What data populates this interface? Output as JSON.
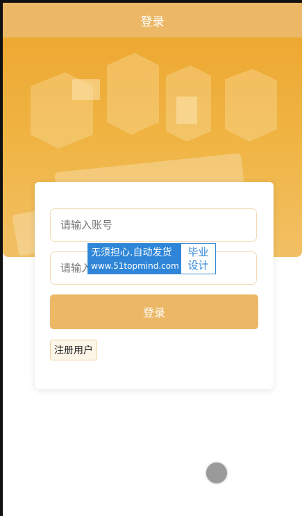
{
  "header": {
    "title": "登录"
  },
  "login_form": {
    "account_placeholder": "请输入账号",
    "password_placeholder": "请输入密码",
    "login_label": "登录",
    "register_label": "注册用户"
  },
  "watermark": {
    "slogan": "无须担心.自动发货",
    "url": "www.51topmind.com",
    "tag_line1": "毕业",
    "tag_line2": "设计"
  },
  "colors": {
    "accent": "#ecb866",
    "hero": "#f0b545",
    "field_border": "#f2dcb8",
    "watermark_blue": "#2f86d8"
  },
  "icons": {
    "touch_indicator": "touch-dot-icon"
  }
}
